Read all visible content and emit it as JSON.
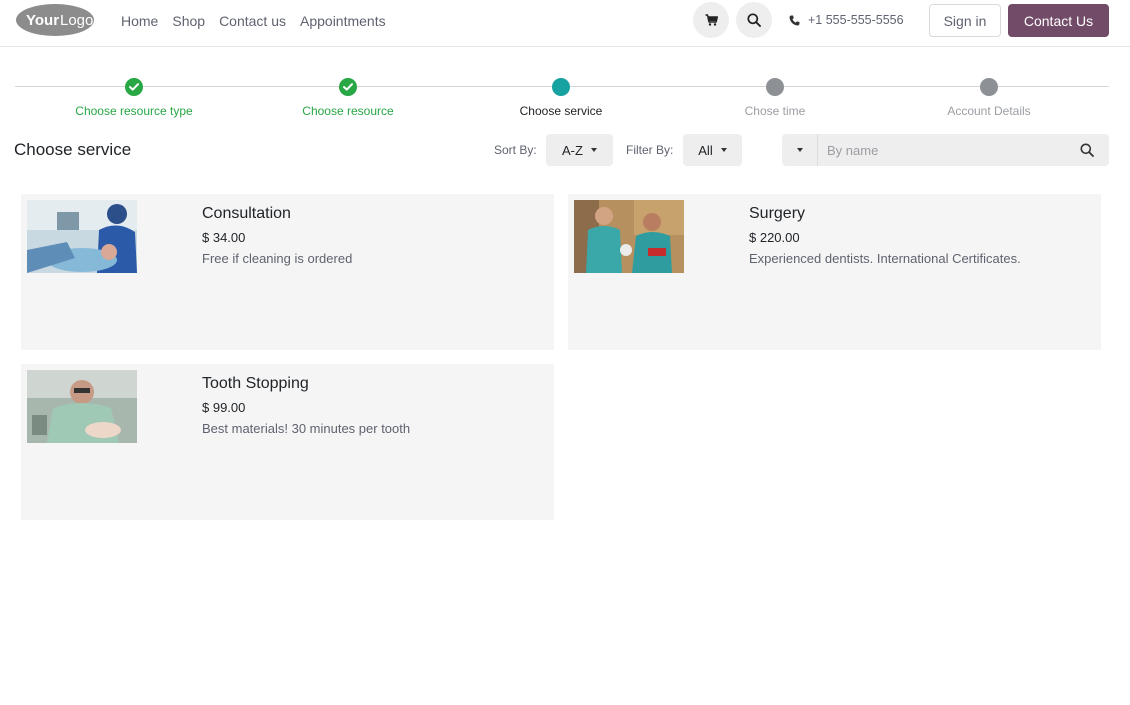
{
  "header": {
    "logo_text": "YourLogo",
    "nav": [
      {
        "label": "Home"
      },
      {
        "label": "Shop"
      },
      {
        "label": "Contact us"
      },
      {
        "label": "Appointments"
      }
    ],
    "phone": "+1 555-555-5556",
    "signin_label": "Sign in",
    "contact_label": "Contact Us",
    "icons": {
      "cart": "cart-icon",
      "search": "search-icon",
      "phone": "phone-icon"
    }
  },
  "stepper": {
    "steps": [
      {
        "label": "Choose resource type",
        "state": "done"
      },
      {
        "label": "Choose resource",
        "state": "done"
      },
      {
        "label": "Choose service",
        "state": "current"
      },
      {
        "label": "Chose time",
        "state": "todo"
      },
      {
        "label": "Account Details",
        "state": "todo"
      }
    ]
  },
  "toolbar": {
    "title": "Choose service",
    "sort_label": "Sort By:",
    "sort_value": "A-Z",
    "filter_label": "Filter By:",
    "filter_value": "All",
    "search_placeholder": "By name"
  },
  "services": [
    {
      "name": "Consultation",
      "price": "$ 34.00",
      "description": "Free if cleaning is ordered"
    },
    {
      "name": "Surgery",
      "price": "$ 220.00",
      "description": "Experienced dentists. International Certificates."
    },
    {
      "name": "Tooth Stopping",
      "price": "$ 99.00",
      "description": "Best materials! 30 minutes per tooth"
    }
  ],
  "colors": {
    "brand": "#714b67",
    "done": "#28a745",
    "current": "#17a2a2",
    "todo": "#8d9196"
  }
}
